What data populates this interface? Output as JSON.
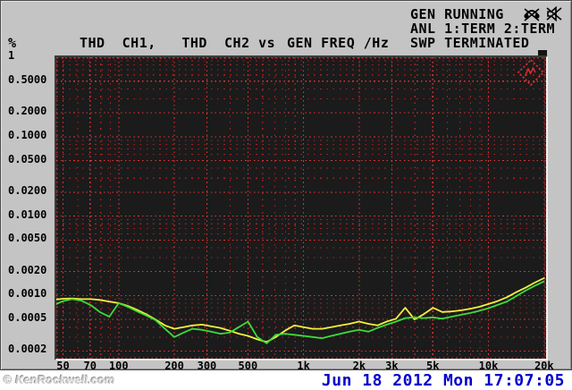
{
  "header": {
    "trace_title": "THD  CH1,   THD  CH2 vs",
    "x_title": "GEN FREQ /Hz",
    "status_lines": [
      "GEN RUNNING",
      "ANL 1:TERM 2:TERM",
      "SWP TERMINATED"
    ],
    "status_icons": [
      "monitor-muted-icon",
      "speaker-muted-icon"
    ]
  },
  "footer": {
    "watermark": "© KenRockwell.com",
    "datetime": "Jun 18 2012 Mon 17:07:05",
    "datetime_color": "#0000cc"
  },
  "chart_data": {
    "type": "line",
    "title": "THD CH1, THD CH2 vs GEN FREQ /Hz",
    "bg": "#1b1b1b",
    "grid": true,
    "grid_color_major": "#e83232",
    "grid_color_minor": "#ab2222",
    "logo": "rohde-schwarz-logo",
    "logo_color": "#e03030",
    "x_axis": {
      "label": "GEN FREQ /Hz",
      "scale": "log",
      "min": 46,
      "max": 20500,
      "tick_values": [
        50,
        70,
        100,
        200,
        300,
        500,
        1000,
        2000,
        3000,
        5000,
        10000,
        20000
      ],
      "tick_labels": [
        "50",
        "70",
        "100",
        "200",
        "300",
        "500",
        "1k",
        "2k",
        "3k",
        "5k",
        "10k",
        "20k"
      ]
    },
    "y_axis": {
      "label": "THD",
      "unit": "%",
      "scale": "log",
      "min": 0.00016,
      "max": 1.0,
      "tick_values": [
        1,
        0.5,
        0.2,
        0.1,
        0.05,
        0.02,
        0.01,
        0.005,
        0.002,
        0.001,
        0.0005,
        0.0002
      ],
      "tick_labels": [
        "1",
        "0.5000",
        "0.2000",
        "0.1000",
        "0.0500",
        "0.0200",
        "0.0100",
        "0.0050",
        "0.0020",
        "0.0010",
        "0.0005",
        "0.0002"
      ]
    },
    "x": [
      46,
      50,
      56,
      63,
      71,
      79,
      89,
      100,
      112,
      126,
      141,
      158,
      178,
      200,
      224,
      251,
      282,
      316,
      355,
      398,
      447,
      501,
      562,
      631,
      708,
      794,
      891,
      1000,
      1122,
      1259,
      1413,
      1585,
      1778,
      1995,
      2239,
      2512,
      2818,
      3162,
      3548,
      3981,
      4467,
      5012,
      5623,
      6310,
      7079,
      7943,
      8913,
      10000,
      11220,
      12589,
      14125,
      15849,
      17783,
      19953
    ],
    "series": [
      {
        "name": "THD CH1",
        "color": "#f2f23c",
        "values": [
          0.00089,
          0.00091,
          0.00092,
          0.0009,
          0.0009,
          0.00088,
          0.00084,
          0.0008,
          0.00074,
          0.00066,
          0.00058,
          0.0005,
          0.00042,
          0.00038,
          0.0004,
          0.00042,
          0.00043,
          0.00041,
          0.00039,
          0.00036,
          0.00033,
          0.00031,
          0.00028,
          0.00026,
          0.0003,
          0.00036,
          0.00042,
          0.0004,
          0.00038,
          0.00038,
          0.0004,
          0.00042,
          0.00044,
          0.00047,
          0.00044,
          0.00042,
          0.00047,
          0.00051,
          0.0007,
          0.0005,
          0.00058,
          0.0007,
          0.00062,
          0.00063,
          0.00065,
          0.00068,
          0.00072,
          0.00078,
          0.00085,
          0.00095,
          0.0011,
          0.00125,
          0.00145,
          0.00165
        ]
      },
      {
        "name": "THD CH2",
        "color": "#3cdc3c",
        "values": [
          0.00078,
          0.00085,
          0.0009,
          0.00086,
          0.00075,
          0.00062,
          0.00054,
          0.0008,
          0.00072,
          0.00063,
          0.00056,
          0.00049,
          0.00038,
          0.0003,
          0.00034,
          0.00038,
          0.00037,
          0.00035,
          0.00033,
          0.00034,
          0.0004,
          0.00047,
          0.0003,
          0.00025,
          0.00032,
          0.00033,
          0.00032,
          0.00031,
          0.0003,
          0.00029,
          0.00031,
          0.00033,
          0.00035,
          0.00037,
          0.00035,
          0.00039,
          0.00043,
          0.00047,
          0.00052,
          0.00053,
          0.00052,
          0.00053,
          0.00051,
          0.00054,
          0.00057,
          0.0006,
          0.00064,
          0.00069,
          0.00076,
          0.00084,
          0.00098,
          0.00115,
          0.00132,
          0.0015
        ]
      }
    ]
  }
}
